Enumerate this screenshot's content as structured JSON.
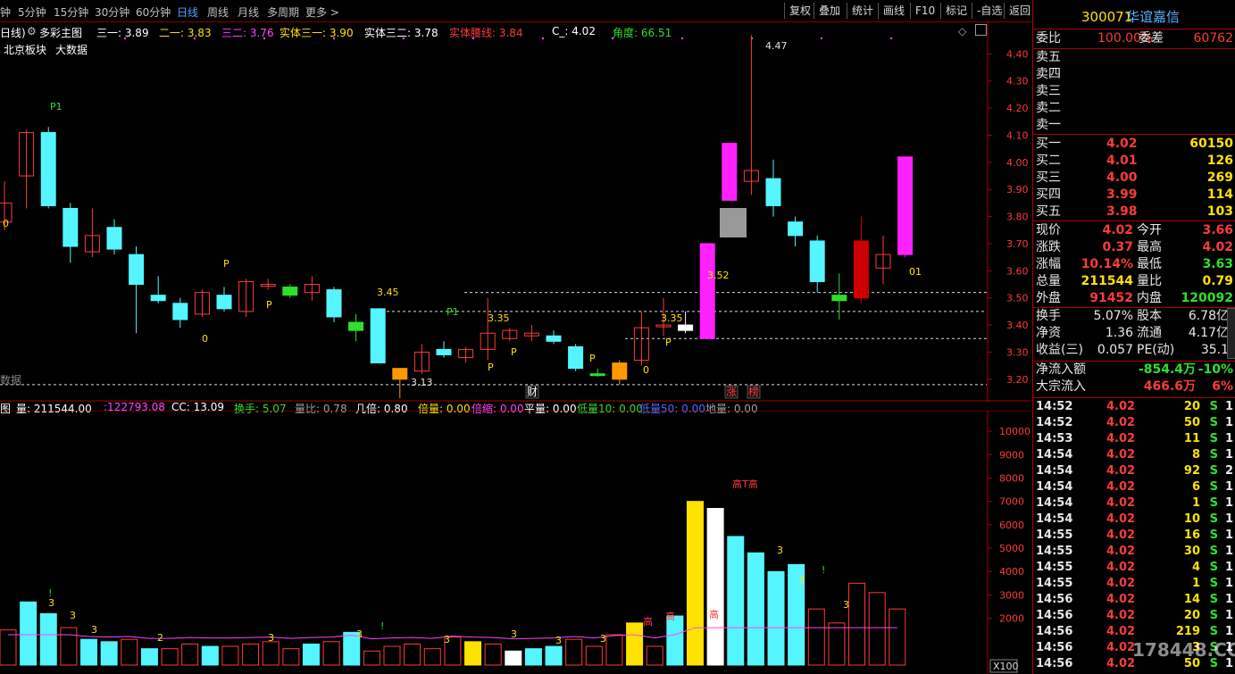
{
  "toolbar": {
    "periods": [
      "钟",
      "5分钟",
      "15分钟",
      "30分钟",
      "60分钟",
      "日线",
      "周线",
      "月线",
      "多周期",
      "更多 >"
    ],
    "active_period": "日线",
    "buttons": [
      "复权",
      "叠加",
      "统计",
      "画线",
      "F10",
      "标记",
      "-自选",
      "返回"
    ]
  },
  "main_legend": {
    "prefix": "日线)",
    "indicator_name": "多彩主图",
    "items": [
      {
        "label": "三一: 3.89",
        "color": "#ffffff"
      },
      {
        "label": "二一: 3.83",
        "color": "#ffe200"
      },
      {
        "label": "三二: 3.76",
        "color": "#ff44ff"
      },
      {
        "label": "实体三一: 3.90",
        "color": "#ffe200"
      },
      {
        "label": "实体三二: 3.78",
        "color": "#ffffff"
      },
      {
        "label": "实体腰线: 3.84",
        "color": "#ff3a3a"
      },
      {
        "label": "C_: 4.02",
        "color": "#ffffff"
      },
      {
        "label": "角度: 66.51",
        "color": "#2ee02e"
      }
    ],
    "sub_tags": [
      "北京板块",
      "大数据"
    ]
  },
  "price_axis": [
    "4.40",
    "4.30",
    "4.20",
    "4.10",
    "4.00",
    "3.90",
    "3.80",
    "3.70",
    "3.60",
    "3.50",
    "3.40",
    "3.30",
    "3.20"
  ],
  "chart_annotations": {
    "high_label": "4.47",
    "low_label": "3.13",
    "p_labels": [
      "P1",
      "P",
      "P",
      "P1",
      "P",
      "P",
      "P",
      "P"
    ],
    "level_labels": [
      "3.45",
      "3.35",
      "3.35",
      "3.52"
    ],
    "zero_labels": [
      "0",
      "0",
      "0",
      "0"
    ],
    "event_tags": [
      "财",
      "涨",
      "榜"
    ],
    "badge_01": "01",
    "left_cut": "数据"
  },
  "vol_legend": {
    "prefix": "图",
    "items": [
      {
        "label": "量: 211544.00",
        "color": "#ffffff"
      },
      {
        "label": ":122793.08",
        "color": "#ff44ff"
      },
      {
        "label": "CC: 13.09",
        "color": "#ffffff"
      },
      {
        "label": "换手: 5.07",
        "color": "#2ee02e"
      },
      {
        "label": "量比: 0.78",
        "color": "#a0a0a0"
      },
      {
        "label": "几倍: 0.80",
        "color": "#ffffff"
      },
      {
        "label": "倍量: 0.00",
        "color": "#ffe200"
      },
      {
        "label": "倍缩: 0.00",
        "color": "#ff44ff"
      },
      {
        "label": "平量: 0.00",
        "color": "#ffffff"
      },
      {
        "label": "低量10: 0.00",
        "color": "#2ee02e"
      },
      {
        "label": "低量50: 0.00",
        "color": "#4a6bff"
      },
      {
        "label": "地量: 0.00",
        "color": "#a0a0a0"
      }
    ]
  },
  "vol_axis": [
    "10000",
    "9000",
    "8000",
    "7000",
    "6000",
    "5000",
    "4000",
    "3000",
    "2000"
  ],
  "vol_multiplier": "X100",
  "vol_annotations": {
    "peak_label": "高T高",
    "high_marks": [
      "高",
      "高",
      "高"
    ],
    "digits": [
      "3",
      "3",
      "3",
      "2",
      "3",
      "3",
      "3",
      "3",
      "3",
      "3",
      "3",
      "3",
      "3",
      "3"
    ],
    "bangs": [
      "!",
      "!",
      "!"
    ]
  },
  "chart_data": {
    "type": "candlestick",
    "ylim": [
      3.15,
      4.5
    ],
    "candles": [
      {
        "o": 3.85,
        "h": 3.93,
        "l": 3.75,
        "c": 3.78,
        "color": "red"
      },
      {
        "o": 3.95,
        "h": 4.12,
        "l": 3.83,
        "c": 4.11,
        "color": "red"
      },
      {
        "o": 4.11,
        "h": 4.13,
        "l": 3.83,
        "c": 3.84,
        "color": "cyan"
      },
      {
        "o": 3.83,
        "h": 3.85,
        "l": 3.63,
        "c": 3.69,
        "color": "cyan"
      },
      {
        "o": 3.67,
        "h": 3.83,
        "l": 3.65,
        "c": 3.73,
        "color": "red"
      },
      {
        "o": 3.76,
        "h": 3.79,
        "l": 3.66,
        "c": 3.68,
        "color": "cyan"
      },
      {
        "o": 3.66,
        "h": 3.69,
        "l": 3.37,
        "c": 3.55,
        "color": "cyan"
      },
      {
        "o": 3.51,
        "h": 3.58,
        "l": 3.48,
        "c": 3.49,
        "color": "cyan"
      },
      {
        "o": 3.48,
        "h": 3.5,
        "l": 3.39,
        "c": 3.42,
        "color": "cyan"
      },
      {
        "o": 3.44,
        "h": 3.53,
        "l": 3.43,
        "c": 3.52,
        "color": "red"
      },
      {
        "o": 3.51,
        "h": 3.54,
        "l": 3.45,
        "c": 3.46,
        "color": "cyan"
      },
      {
        "o": 3.45,
        "h": 3.57,
        "l": 3.43,
        "c": 3.56,
        "color": "red"
      },
      {
        "o": 3.55,
        "h": 3.57,
        "l": 3.53,
        "c": 3.55,
        "color": "red"
      },
      {
        "o": 3.51,
        "h": 3.55,
        "l": 3.5,
        "c": 3.54,
        "color": "green"
      },
      {
        "o": 3.52,
        "h": 3.58,
        "l": 3.49,
        "c": 3.55,
        "color": "red"
      },
      {
        "o": 3.53,
        "h": 3.54,
        "l": 3.41,
        "c": 3.43,
        "color": "cyan"
      },
      {
        "o": 3.41,
        "h": 3.44,
        "l": 3.34,
        "c": 3.38,
        "color": "green"
      },
      {
        "o": 3.46,
        "h": 3.46,
        "l": 3.26,
        "c": 3.26,
        "color": "cyan"
      },
      {
        "o": 3.2,
        "h": 3.24,
        "l": 3.13,
        "c": 3.24,
        "color": "orange"
      },
      {
        "o": 3.23,
        "h": 3.33,
        "l": 3.22,
        "c": 3.3,
        "color": "red"
      },
      {
        "o": 3.31,
        "h": 3.34,
        "l": 3.28,
        "c": 3.29,
        "color": "cyan"
      },
      {
        "o": 3.28,
        "h": 3.32,
        "l": 3.26,
        "c": 3.31,
        "color": "red"
      },
      {
        "o": 3.31,
        "h": 3.5,
        "l": 3.27,
        "c": 3.37,
        "color": "red"
      },
      {
        "o": 3.35,
        "h": 3.39,
        "l": 3.34,
        "c": 3.38,
        "color": "red"
      },
      {
        "o": 3.37,
        "h": 3.4,
        "l": 3.34,
        "c": 3.36,
        "color": "red"
      },
      {
        "o": 3.36,
        "h": 3.38,
        "l": 3.33,
        "c": 3.34,
        "color": "cyan"
      },
      {
        "o": 3.32,
        "h": 3.33,
        "l": 3.23,
        "c": 3.24,
        "color": "cyan"
      },
      {
        "o": 3.22,
        "h": 3.24,
        "l": 3.21,
        "c": 3.22,
        "color": "green"
      },
      {
        "o": 3.2,
        "h": 3.27,
        "l": 3.18,
        "c": 3.26,
        "color": "orange"
      },
      {
        "o": 3.27,
        "h": 3.45,
        "l": 3.25,
        "c": 3.39,
        "color": "red"
      },
      {
        "o": 3.4,
        "h": 3.5,
        "l": 3.36,
        "c": 3.4,
        "color": "red"
      },
      {
        "o": 3.4,
        "h": 3.45,
        "l": 3.37,
        "c": 3.38,
        "color": "white"
      },
      {
        "o": 3.35,
        "h": 3.7,
        "l": 3.35,
        "c": 3.7,
        "color": "magenta"
      },
      {
        "o": 3.86,
        "h": 4.07,
        "l": 3.86,
        "c": 4.07,
        "color": "magenta"
      },
      {
        "o": 3.93,
        "h": 4.47,
        "l": 3.88,
        "c": 3.97,
        "color": "red"
      },
      {
        "o": 3.94,
        "h": 4.01,
        "l": 3.8,
        "c": 3.84,
        "color": "cyan"
      },
      {
        "o": 3.78,
        "h": 3.8,
        "l": 3.69,
        "c": 3.73,
        "color": "cyan"
      },
      {
        "o": 3.71,
        "h": 3.73,
        "l": 3.52,
        "c": 3.56,
        "color": "cyan"
      },
      {
        "o": 3.51,
        "h": 3.59,
        "l": 3.42,
        "c": 3.49,
        "color": "green"
      },
      {
        "o": 3.5,
        "h": 3.8,
        "l": 3.48,
        "c": 3.71,
        "color": "darkred"
      },
      {
        "o": 3.61,
        "h": 3.73,
        "l": 3.55,
        "c": 3.66,
        "color": "red"
      },
      {
        "o": 3.66,
        "h": 4.02,
        "l": 3.65,
        "c": 4.02,
        "color": "magenta"
      }
    ],
    "volumes": [
      1500,
      2700,
      2200,
      1600,
      1100,
      1000,
      1100,
      700,
      700,
      900,
      800,
      800,
      900,
      1000,
      700,
      900,
      1000,
      1400,
      600,
      800,
      900,
      700,
      1200,
      1000,
      900,
      600,
      700,
      800,
      1100,
      800,
      1300,
      1800,
      800,
      2100,
      7000,
      6700,
      5500,
      4800,
      4000,
      4300,
      2400,
      1800,
      3500,
      3100,
      2400
    ],
    "vol_colors": [
      "hollow",
      "cyan",
      "cyan",
      "hollow",
      "cyan",
      "cyan",
      "hollow",
      "cyan",
      "hollow",
      "hollow",
      "cyan",
      "hollow",
      "hollow",
      "hollow",
      "hollow",
      "cyan",
      "hollow",
      "cyan",
      "hollow",
      "hollow",
      "hollow",
      "hollow",
      "hollow",
      "yellow",
      "hollow",
      "white",
      "cyan",
      "cyan",
      "hollow",
      "hollow",
      "hollow",
      "yellow",
      "hollow",
      "cyan",
      "yellow",
      "white",
      "cyan",
      "cyan",
      "cyan",
      "cyan",
      "hollow",
      "hollow",
      "hollow",
      "hollow",
      "hollow"
    ]
  },
  "stock": {
    "code": "300071",
    "name": "华谊嘉信"
  },
  "order_book": {
    "weibi": {
      "label": "委比",
      "value": "100.00%",
      "label2": "委差",
      "value2": "60762"
    },
    "asks": [
      {
        "label": "卖五",
        "price": "",
        "vol": ""
      },
      {
        "label": "卖四",
        "price": "",
        "vol": ""
      },
      {
        "label": "卖三",
        "price": "",
        "vol": ""
      },
      {
        "label": "卖二",
        "price": "",
        "vol": ""
      },
      {
        "label": "卖一",
        "price": "",
        "vol": ""
      }
    ],
    "bids": [
      {
        "label": "买一",
        "price": "4.02",
        "vol": "60150"
      },
      {
        "label": "买二",
        "price": "4.01",
        "vol": "126"
      },
      {
        "label": "买三",
        "price": "4.00",
        "vol": "269"
      },
      {
        "label": "买四",
        "price": "3.99",
        "vol": "114"
      },
      {
        "label": "买五",
        "price": "3.98",
        "vol": "103"
      }
    ]
  },
  "quote": [
    {
      "l1": "现价",
      "v1": "4.02",
      "c1": "red",
      "l2": "今开",
      "v2": "3.66",
      "c2": "red"
    },
    {
      "l1": "涨跌",
      "v1": "0.37",
      "c1": "red",
      "l2": "最高",
      "v2": "4.02",
      "c2": "red"
    },
    {
      "l1": "涨幅",
      "v1": "10.14%",
      "c1": "red",
      "l2": "最低",
      "v2": "3.63",
      "c2": "green"
    },
    {
      "l1": "总量",
      "v1": "211544",
      "c1": "yellow",
      "l2": "量比",
      "v2": "0.79",
      "c2": "yellow"
    },
    {
      "l1": "外盘",
      "v1": "91452",
      "c1": "red",
      "l2": "内盘",
      "v2": "120092",
      "c2": "green"
    }
  ],
  "fundamentals": [
    {
      "l1": "换手",
      "v1": "5.07%",
      "l2": "股本",
      "v2": "6.78亿"
    },
    {
      "l1": "净资",
      "v1": "1.36",
      "l2": "流通",
      "v2": "4.17亿"
    },
    {
      "l1": "收益(三)",
      "v1": "0.057",
      "l2": "PE(动)",
      "v2": "35.1"
    }
  ],
  "flows": [
    {
      "label": "净流入额",
      "value": "-854.4万",
      "pct": "-10%",
      "color": "green"
    },
    {
      "label": "大宗流入",
      "value": "466.6万",
      "pct": "6%",
      "color": "red"
    }
  ],
  "ticks": [
    {
      "t": "14:52",
      "p": "4.02",
      "v": "20",
      "s": "S",
      "n": "1"
    },
    {
      "t": "14:52",
      "p": "4.02",
      "v": "50",
      "s": "S",
      "n": "1"
    },
    {
      "t": "14:53",
      "p": "4.02",
      "v": "11",
      "s": "S",
      "n": "1"
    },
    {
      "t": "14:54",
      "p": "4.02",
      "v": "8",
      "s": "S",
      "n": "1"
    },
    {
      "t": "14:54",
      "p": "4.02",
      "v": "92",
      "s": "S",
      "n": "2"
    },
    {
      "t": "14:54",
      "p": "4.02",
      "v": "6",
      "s": "S",
      "n": "1"
    },
    {
      "t": "14:54",
      "p": "4.02",
      "v": "1",
      "s": "S",
      "n": "1"
    },
    {
      "t": "14:54",
      "p": "4.02",
      "v": "10",
      "s": "S",
      "n": "1"
    },
    {
      "t": "14:55",
      "p": "4.02",
      "v": "16",
      "s": "S",
      "n": "1"
    },
    {
      "t": "14:55",
      "p": "4.02",
      "v": "30",
      "s": "S",
      "n": "1"
    },
    {
      "t": "14:55",
      "p": "4.02",
      "v": "4",
      "s": "S",
      "n": "1"
    },
    {
      "t": "14:55",
      "p": "4.02",
      "v": "1",
      "s": "S",
      "n": "1"
    },
    {
      "t": "14:56",
      "p": "4.02",
      "v": "14",
      "s": "S",
      "n": "1"
    },
    {
      "t": "14:56",
      "p": "4.02",
      "v": "20",
      "s": "S",
      "n": "1"
    },
    {
      "t": "14:56",
      "p": "4.02",
      "v": "219",
      "s": "S",
      "n": "1"
    },
    {
      "t": "14:56",
      "p": "4.02",
      "v": "3",
      "s": "S",
      "n": "1"
    },
    {
      "t": "14:56",
      "p": "4.02",
      "v": "50",
      "s": "S",
      "n": "1"
    }
  ],
  "watermark": "178448.COM"
}
